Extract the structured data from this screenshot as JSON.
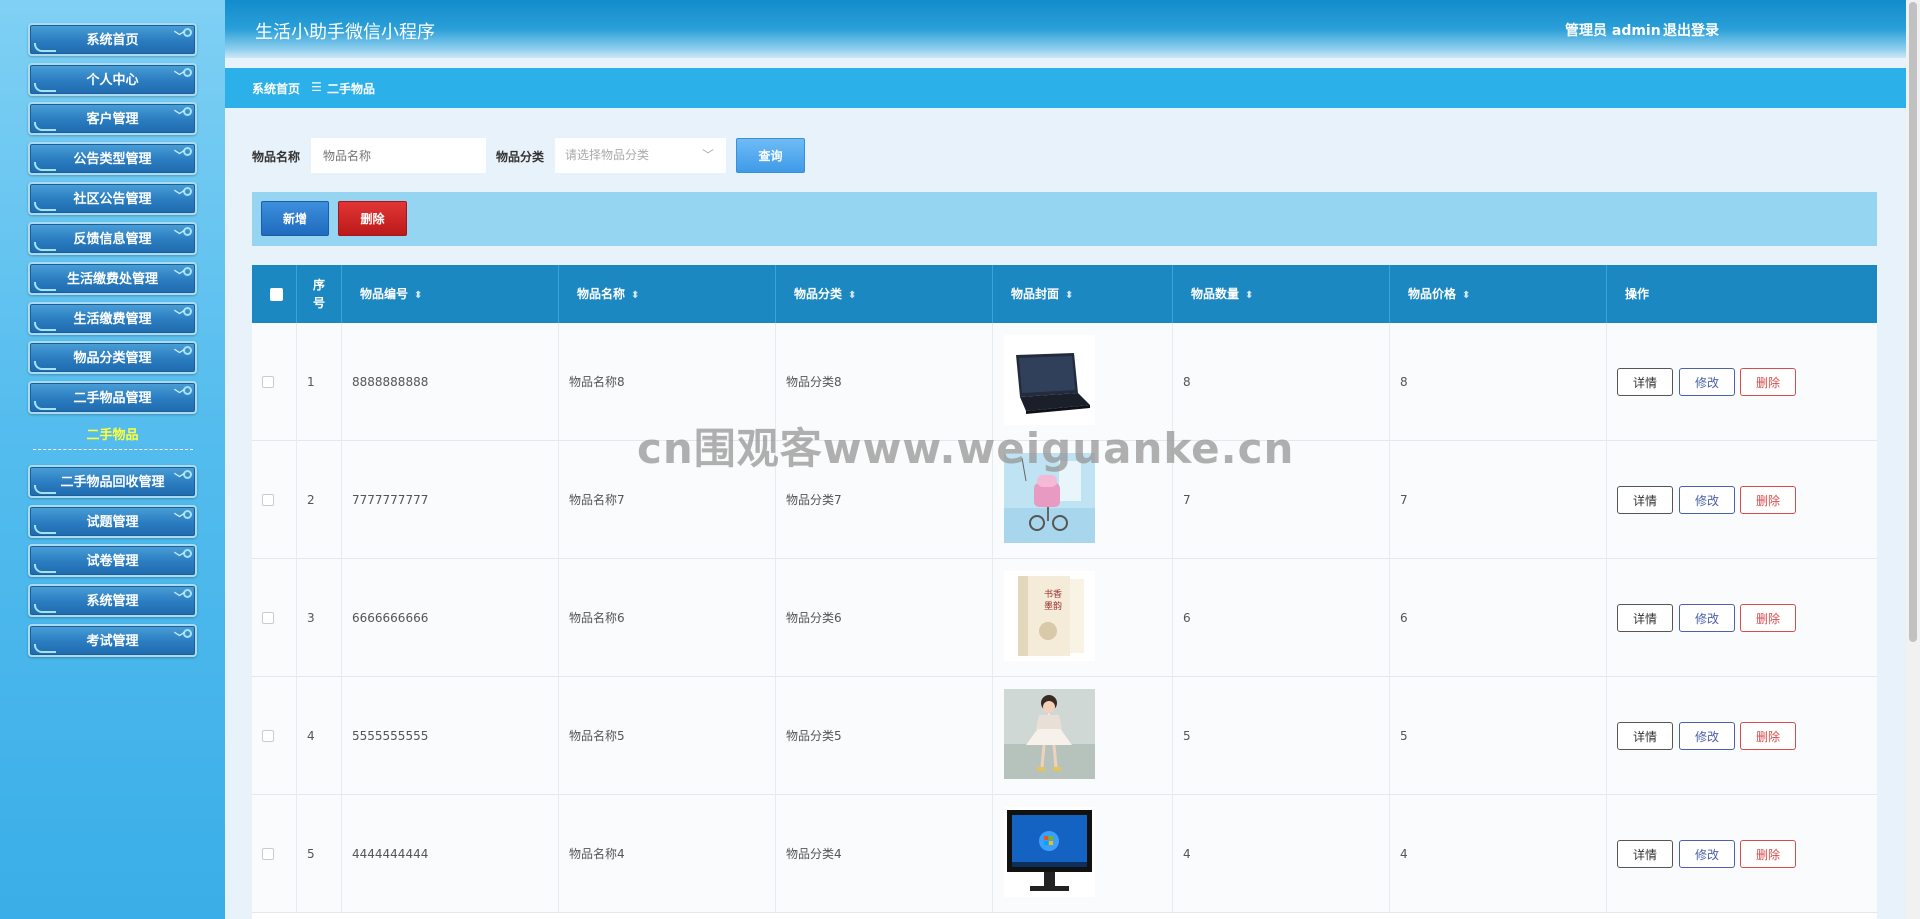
{
  "header": {
    "title": "生活小助手微信小程序",
    "user": "管理员 admin",
    "logout": "退出登录"
  },
  "sidebar": {
    "items_top": [
      "系统首页",
      "个人中心",
      "客户管理",
      "公告类型管理",
      "社区公告管理",
      "反馈信息管理",
      "生活缴费处管理",
      "生活缴费管理",
      "物品分类管理",
      "二手物品管理"
    ],
    "active_sub": "二手物品",
    "items_bottom": [
      "二手物品回收管理",
      "试题管理",
      "试卷管理",
      "系统管理",
      "考试管理"
    ]
  },
  "breadcrumb": {
    "home": "系统首页",
    "sep": "☰",
    "current": "二手物品"
  },
  "search": {
    "name_label": "物品名称",
    "name_placeholder": "物品名称",
    "category_label": "物品分类",
    "category_placeholder": "请选择物品分类",
    "query_button": "查询"
  },
  "actions": {
    "add": "新增",
    "delete": "删除"
  },
  "table": {
    "columns": [
      "序号",
      "物品编号",
      "物品名称",
      "物品分类",
      "物品封面",
      "物品数量",
      "物品价格",
      "操作"
    ],
    "seq_header": [
      "序",
      "号"
    ],
    "row_buttons": {
      "detail": "详情",
      "edit": "修改",
      "remove": "删除"
    },
    "rows": [
      {
        "seq": "1",
        "code": "8888888888",
        "name": "物品名称8",
        "category": "物品分类8",
        "cover": "laptop",
        "qty": "8",
        "price": "8"
      },
      {
        "seq": "2",
        "code": "7777777777",
        "name": "物品名称7",
        "category": "物品分类7",
        "cover": "stroller",
        "qty": "7",
        "price": "7"
      },
      {
        "seq": "3",
        "code": "6666666666",
        "name": "物品名称6",
        "category": "物品分类6",
        "cover": "book",
        "qty": "6",
        "price": "6"
      },
      {
        "seq": "4",
        "code": "5555555555",
        "name": "物品名称5",
        "category": "物品分类5",
        "cover": "dress",
        "qty": "5",
        "price": "5"
      },
      {
        "seq": "5",
        "code": "4444444444",
        "name": "物品名称4",
        "category": "物品分类4",
        "cover": "monitor",
        "qty": "4",
        "price": "4"
      }
    ]
  },
  "watermark": "cn围观客www.weiguanke.cn"
}
